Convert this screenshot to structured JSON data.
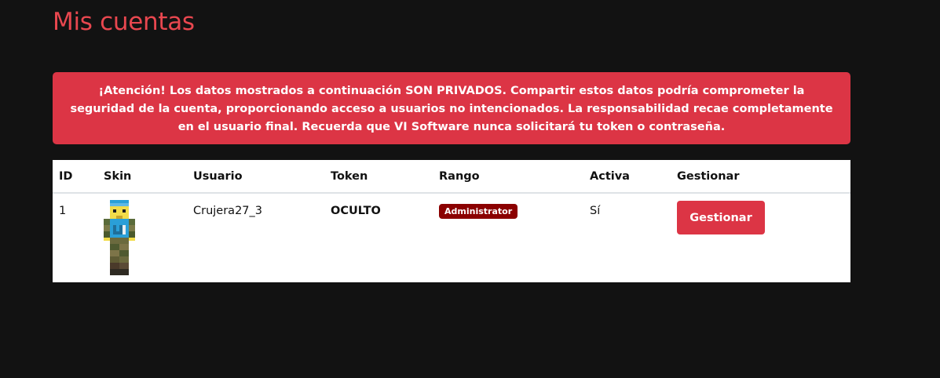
{
  "page": {
    "title": "Mis cuentas"
  },
  "alert": {
    "strong": "¡Atención!",
    "text": " Los datos mostrados a continuación SON PRIVADOS. Compartir estos datos podría comprometer la seguridad de la cuenta, proporcionando acceso a usuarios no intencionados. La responsabilidad recae completamente en el usuario final. Recuerda que VI Software nunca solicitará tu token o contraseña."
  },
  "table": {
    "headers": {
      "id": "ID",
      "skin": "Skin",
      "user": "Usuario",
      "token": "Token",
      "rank": "Rango",
      "active": "Activa",
      "manage": "Gestionar"
    },
    "rows": [
      {
        "id": "1",
        "skin_icon": "minecraft-skin-avatar",
        "user": "Crujera27_3",
        "token": "OCULTO",
        "rank": "Administrator",
        "active": "Sí",
        "manage_label": "Gestionar"
      }
    ]
  },
  "colors": {
    "background": "#121212",
    "accent": "#dc3545",
    "title": "#e8474f",
    "badge": "#8b0000"
  }
}
